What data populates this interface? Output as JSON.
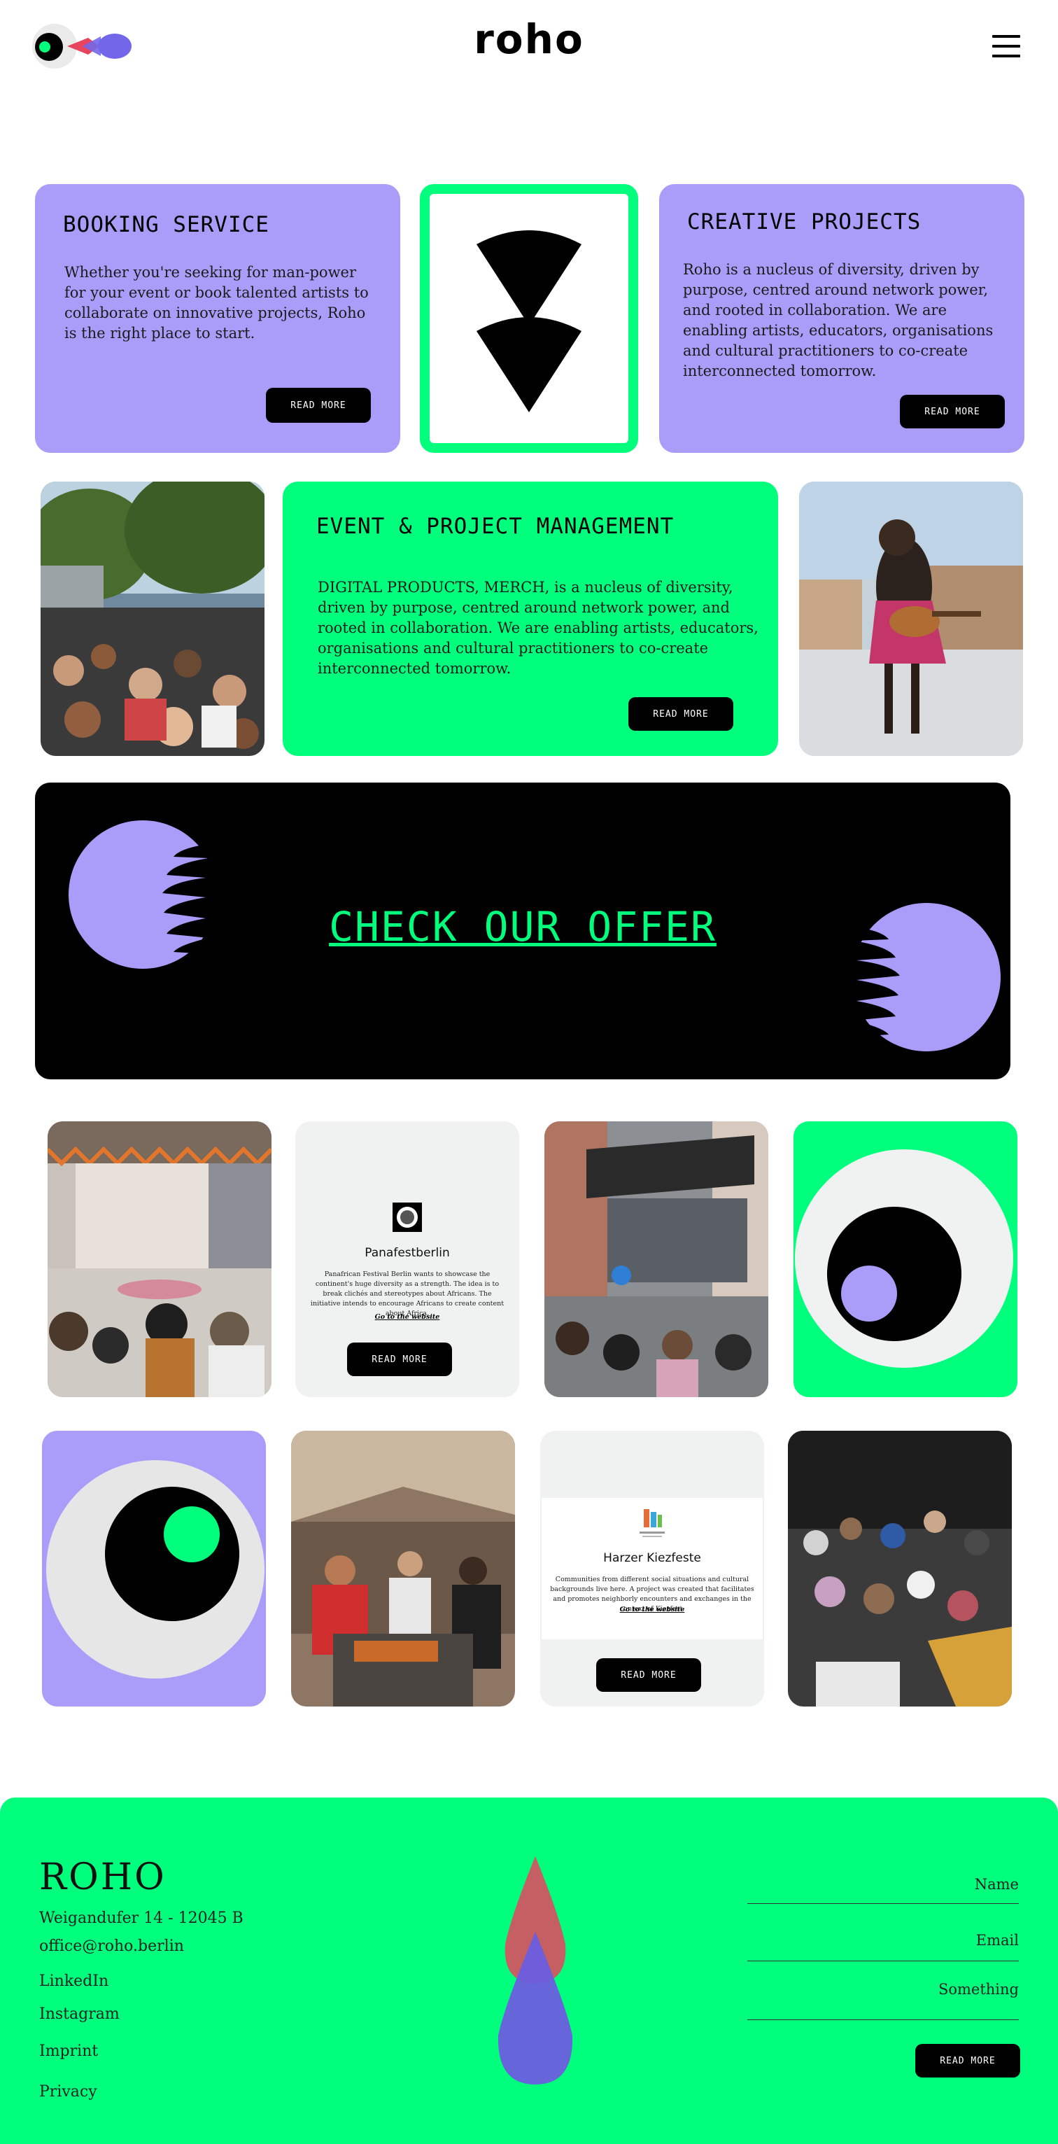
{
  "header": {
    "brand": "roho",
    "logo_icon": "eye-drops-logo-icon",
    "menu_icon": "hamburger-menu-icon"
  },
  "colors": {
    "purple": "#aa9df9",
    "green": "#00ff7d",
    "black": "#000000",
    "light_gray": "#f0f2f1"
  },
  "cards": {
    "booking": {
      "title": "BOOKING SERVICE",
      "text": "Whether you're seeking for man-power for your event or book talented artists to collaborate on innovative projects, Roho is the right place to start.",
      "button": "READ MORE"
    },
    "creative": {
      "title": "CREATIVE PROJECTS",
      "text": "Roho is a nucleus of diversity, driven by purpose, centred around network power, and rooted in collaboration.  We are enabling artists, educators, organisations and cultural practitioners to co-create interconnected tomorrow.",
      "button": "READ MORE"
    },
    "event": {
      "title": "EVENT & PROJECT MANAGEMENT",
      "text": "DIGITAL PRODUCTS, MERCH,  is a nucleus of diversity, driven by purpose, centred around network power, and rooted in collaboration.  We are enabling artists, educators, organisations and cultural practitioners to co-create interconnected tomorrow.",
      "button": "READ MORE"
    }
  },
  "offer": {
    "link": "CHECK OUR OFFER"
  },
  "gallery": {
    "panafest": {
      "title": "Panafestberlin",
      "text": "Panafrican Festival Berlin wants to showcase the continent's huge diversity as a strength. The idea is to break clichés and stereotypes about Africans. The initiative intends to encourage Africans to create content about Africa.",
      "link": "Go to the website",
      "button": "READ MORE"
    },
    "harzer": {
      "title": "Harzer Kiezfeste",
      "text": "Communities from different social situations and cultural backgrounds live here. A project was created that facilitates and promotes neighborly encounters and exchanges in the context of Kiezfest.",
      "link": "Go to the website",
      "button": "READ MORE"
    }
  },
  "footer": {
    "brand": "ROHO",
    "address": "Weigandufer 14 - 12045 B",
    "email": "office@roho.berlin",
    "links": [
      "LinkedIn",
      "Instagram",
      "Imprint",
      "Privacy"
    ],
    "form": {
      "name_placeholder": "Name",
      "email_placeholder": "Email",
      "message_placeholder": "Something",
      "button": "READ MORE"
    }
  }
}
